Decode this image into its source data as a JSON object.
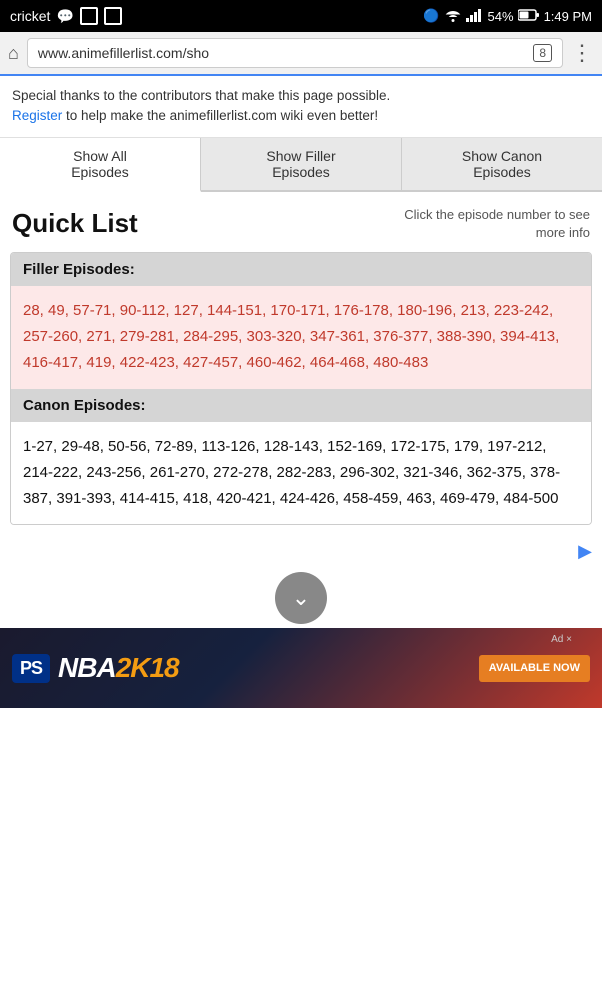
{
  "statusBar": {
    "carrier": "cricket",
    "bluetooth": "🔵",
    "wifi": "wifi",
    "signal": "signal",
    "battery": "54%",
    "time": "1:49 PM"
  },
  "browserBar": {
    "url": "www.animefillerlist.com/sho",
    "tabCount": "8"
  },
  "infoBar": {
    "text": "Special thanks to the contributors that make this page possible.",
    "linkText": "Register",
    "linkSuffix": " to help make the animefillerlist.com wiki even better!"
  },
  "tabs": [
    {
      "label": "Show All\nEpisodes",
      "active": true
    },
    {
      "label": "Show Filler\nEpisodes",
      "active": false
    },
    {
      "label": "Show Canon\nEpisodes",
      "active": false
    }
  ],
  "quickList": {
    "title": "Quick List",
    "hint": "Click the episode number to see more info"
  },
  "fillerSection": {
    "header": "Filler Episodes:",
    "episodes": "28, 49, 57-71, 90-112, 127, 144-151, 170-171, 176-178, 180-196, 213, 223-242, 257-260, 271, 279-281, 284-295, 303-320, 347-361, 376-377, 388-390, 394-413, 416-417, 419, 422-423, 427-457, 460-462, 464-468, 480-483"
  },
  "canonSection": {
    "header": "Canon Episodes:",
    "episodes": "1-27, 29-48, 50-56, 72-89, 113-126, 128-143, 152-169, 172-175, 179, 197-212, 214-222, 243-256, 261-270, 272-278, 282-283, 296-302, 321-346, 362-375, 378-387, 391-393, 414-415, 418, 420-421, 424-426, 458-459, 463, 469-479, 484-500"
  },
  "nbaAd": {
    "psLabel": "PS",
    "title": "NBA2K18",
    "ctaLine1": "AVAILABLE NOW",
    "adLabel": "Ad ×"
  }
}
